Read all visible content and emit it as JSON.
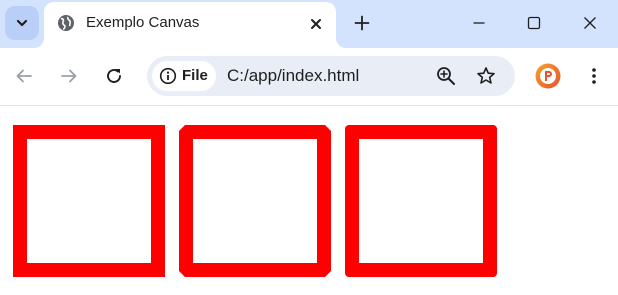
{
  "browser": {
    "tab": {
      "title": "Exemplo Canvas",
      "favicon": "globe-icon"
    },
    "icons": {
      "tab_search": "chevron-down-icon",
      "tab_close": "close-icon",
      "new_tab": "plus-icon",
      "minimize": "minimize-icon",
      "maximize": "maximize-icon",
      "close_window": "close-icon",
      "back": "arrow-left-icon",
      "forward": "arrow-right-icon",
      "reload": "reload-icon",
      "zoom": "zoom-in-icon",
      "bookmark": "star-icon",
      "profile": "profile-avatar-icon",
      "menu": "kebab-menu-icon"
    },
    "omnibox": {
      "site_chip_label": "File",
      "url": "C:/app/index.html"
    },
    "colors": {
      "tabstrip": "#d3e3fd",
      "omnibox": "#e9eef6"
    }
  },
  "canvas": {
    "shape_count": 3,
    "stroke_color": "#ff0000",
    "fill_color": "#ffffff"
  }
}
